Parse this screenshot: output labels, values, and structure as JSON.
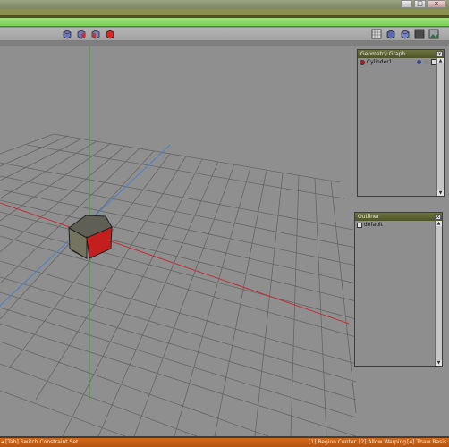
{
  "window": {
    "minimize_glyph": "–",
    "maximize_glyph": "□",
    "close_glyph": "x"
  },
  "toolbar": {
    "left_icons": [
      "cube-blue-icon",
      "cube-blue-red-icon",
      "cube-red-face-icon",
      "cube-red-icon"
    ],
    "right_icons": [
      "grid-display-icon",
      "shaded-cube-icon",
      "wire-cube-icon",
      "background-icon",
      "image-plane-icon"
    ]
  },
  "geometry_graph": {
    "title": "Geometry Graph",
    "close_glyph": "x",
    "items": [
      {
        "label": "Cylinder1",
        "icon": "cylinder-node-icon"
      }
    ]
  },
  "outliner": {
    "title": "Outliner",
    "close_glyph": "x",
    "items": [
      {
        "label": "default",
        "icon": "folder-icon"
      }
    ]
  },
  "status_bar": {
    "hint": "[Tab] Switch Constraint Set",
    "shortcuts": [
      "[1] Region Center",
      "[2] Allow Warping",
      "[4] Thaw Basis"
    ]
  },
  "colors": {
    "title_bar_green": "#8dd96a",
    "panel_header": "#5c6330",
    "status_bar": "#c55f18",
    "x_axis": "#c0303a",
    "y_axis": "#3a9a3a",
    "z_axis": "#4a82c8",
    "object_side": "#c41f1f"
  }
}
